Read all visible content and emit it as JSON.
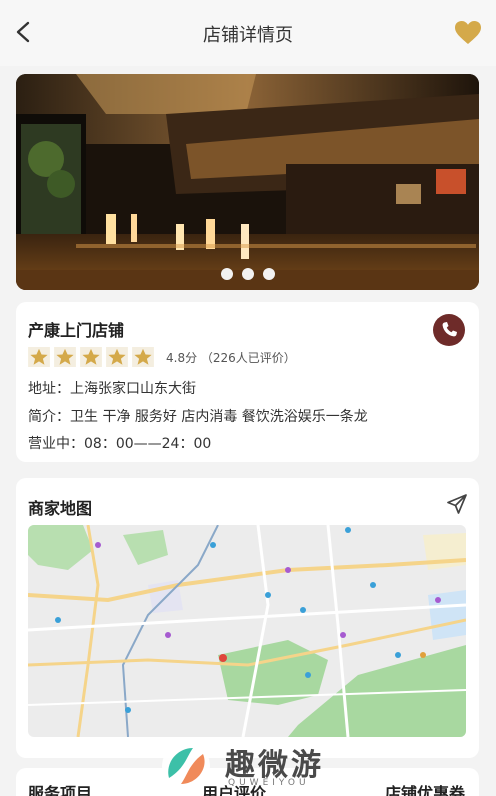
{
  "nav": {
    "title": "店铺详情页",
    "back_icon": "chevron-left-icon",
    "favorite_icon": "heart-icon",
    "favorite_color": "#d4a94a"
  },
  "carousel": {
    "image_alt": "restaurant-interior-photo",
    "dots_count": 3
  },
  "shop": {
    "name": "产康上门店铺",
    "rating_stars": 5,
    "rating_text": "4.8分 （226人已评价）",
    "address": "地址：上海张家口山东大街",
    "intro": "简介：卫生 干净 服务好 店内消毒 餐饮洗浴娱乐一条龙",
    "hours": "营业中：08：00——24：00",
    "phone_icon": "phone-icon",
    "phone_color": "#6e2b29",
    "star_color": "#d4a94a"
  },
  "map_section": {
    "title": "商家地图",
    "send_icon": "navigation-send-icon"
  },
  "bottom_tabs": {
    "left": "服务项目",
    "middle": "用户评价",
    "right": "店铺优惠券"
  },
  "watermark": {
    "text": "趣微游",
    "sub": "QUWEIYOU"
  }
}
